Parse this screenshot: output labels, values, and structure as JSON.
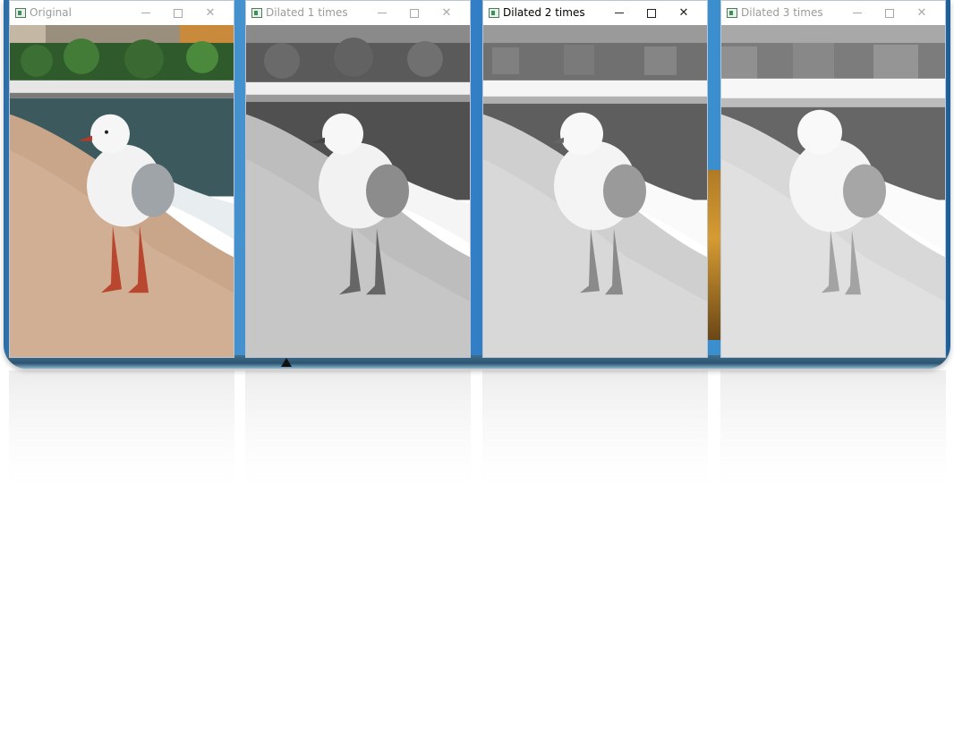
{
  "windows": [
    {
      "title": "Original",
      "active": false,
      "image": "color"
    },
    {
      "title": "Dilated 1 times",
      "active": false,
      "image": "gray1"
    },
    {
      "title": "Dilated 2 times",
      "active": true,
      "image": "gray2"
    },
    {
      "title": "Dilated 3 times",
      "active": false,
      "image": "gray3"
    }
  ],
  "controls": {
    "minimize": "minimize-icon",
    "maximize": "maximize-icon",
    "close": "close-icon"
  },
  "colors": {
    "desktop": "#2d78c0",
    "window_border": "#b9c6d3"
  }
}
